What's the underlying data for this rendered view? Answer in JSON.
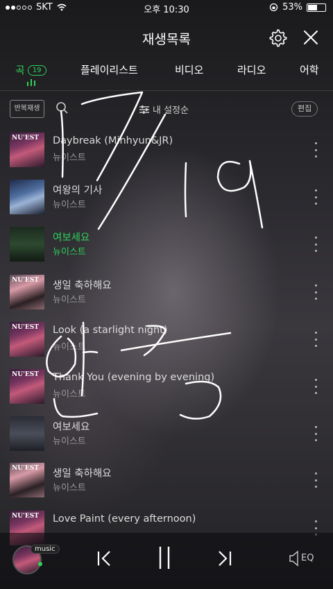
{
  "status_bar": {
    "carrier": "SKT",
    "time": "오후 10:30",
    "battery": "53%",
    "battery_fraction": 0.53
  },
  "header": {
    "title": "재생목록"
  },
  "tabs": [
    {
      "label": "곡",
      "count": "19",
      "active": true
    },
    {
      "label": "플레이리스트"
    },
    {
      "label": "비디오"
    },
    {
      "label": "라디오"
    },
    {
      "label": "어학"
    }
  ],
  "toolbar": {
    "repeat_label": "반복재생",
    "sort_label": "내 설정순",
    "edit_label": "편집"
  },
  "songs": [
    {
      "title": "Daybreak (Minhyun&JR)",
      "artist": "뉴이스트"
    },
    {
      "title": "여왕의 기사",
      "artist": "뉴이스트"
    },
    {
      "title": "여보세요",
      "artist": "뉴이스트",
      "playing": true
    },
    {
      "title": "생일 축하해요",
      "artist": "뉴이스트"
    },
    {
      "title": "Look (a starlight night)",
      "artist": "뉴이스트"
    },
    {
      "title": "Thank You (evening by evening)",
      "artist": "뉴이스트"
    },
    {
      "title": "여보세요",
      "artist": "뉴이스트"
    },
    {
      "title": "생일 축하해요",
      "artist": "뉴이스트"
    },
    {
      "title": "Love Paint (every afternoon)",
      "artist": ""
    }
  ],
  "player": {
    "badge": "music",
    "eq_label": "EQ"
  },
  "accent_color": "#2fd25a",
  "handwriting": "17/19 인증"
}
